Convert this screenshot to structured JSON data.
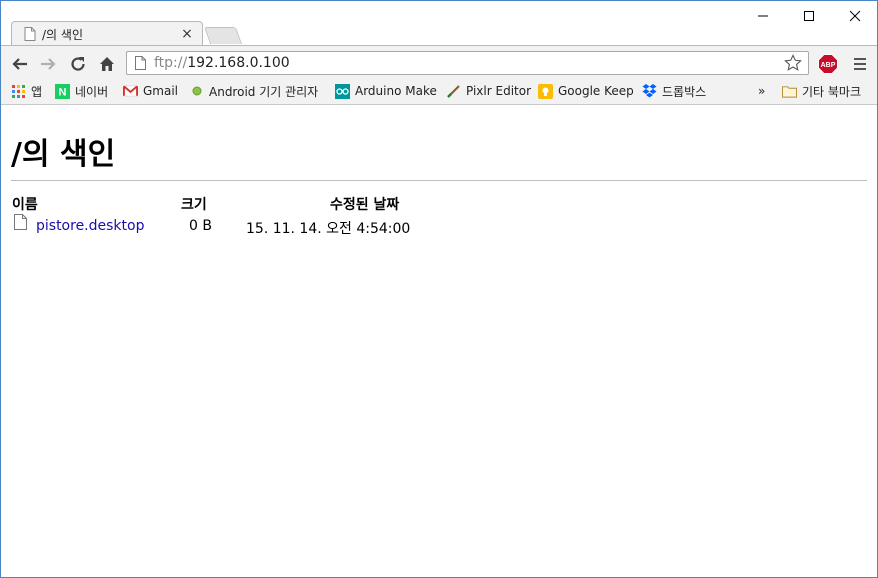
{
  "tab": {
    "title": "/의 색인",
    "close": "×"
  },
  "omnibox": {
    "protocol": "ftp://",
    "host": "192.168.0.100"
  },
  "bookmarks": [
    {
      "label": "앱",
      "icon": "apps-grid-icon"
    },
    {
      "label": "네이버",
      "icon": "naver-icon"
    },
    {
      "label": "Gmail",
      "icon": "gmail-icon"
    },
    {
      "label": "Android 기기 관리자",
      "icon": "android-dot-icon"
    },
    {
      "label": "Arduino Make",
      "icon": "arduino-icon"
    },
    {
      "label": "Pixlr Editor",
      "icon": "pixlr-brush-icon"
    },
    {
      "label": "Google Keep",
      "icon": "google-keep-icon"
    },
    {
      "label": "드롭박스",
      "icon": "dropbox-icon"
    }
  ],
  "bookmarks_overflow": "»",
  "other_bookmarks": "기타 북마크",
  "page": {
    "title": "/의 색인",
    "columns": {
      "name": "이름",
      "size": "크기",
      "modified": "수정된 날짜"
    },
    "rows": [
      {
        "name": "pistore.desktop",
        "size": "0 B",
        "modified": "15. 11. 14. 오전 4:54:00"
      }
    ]
  },
  "colors": {
    "link": "#1a0dab",
    "window_border": "#4a86c5",
    "toolbar_bg": "#f2f2f2"
  }
}
